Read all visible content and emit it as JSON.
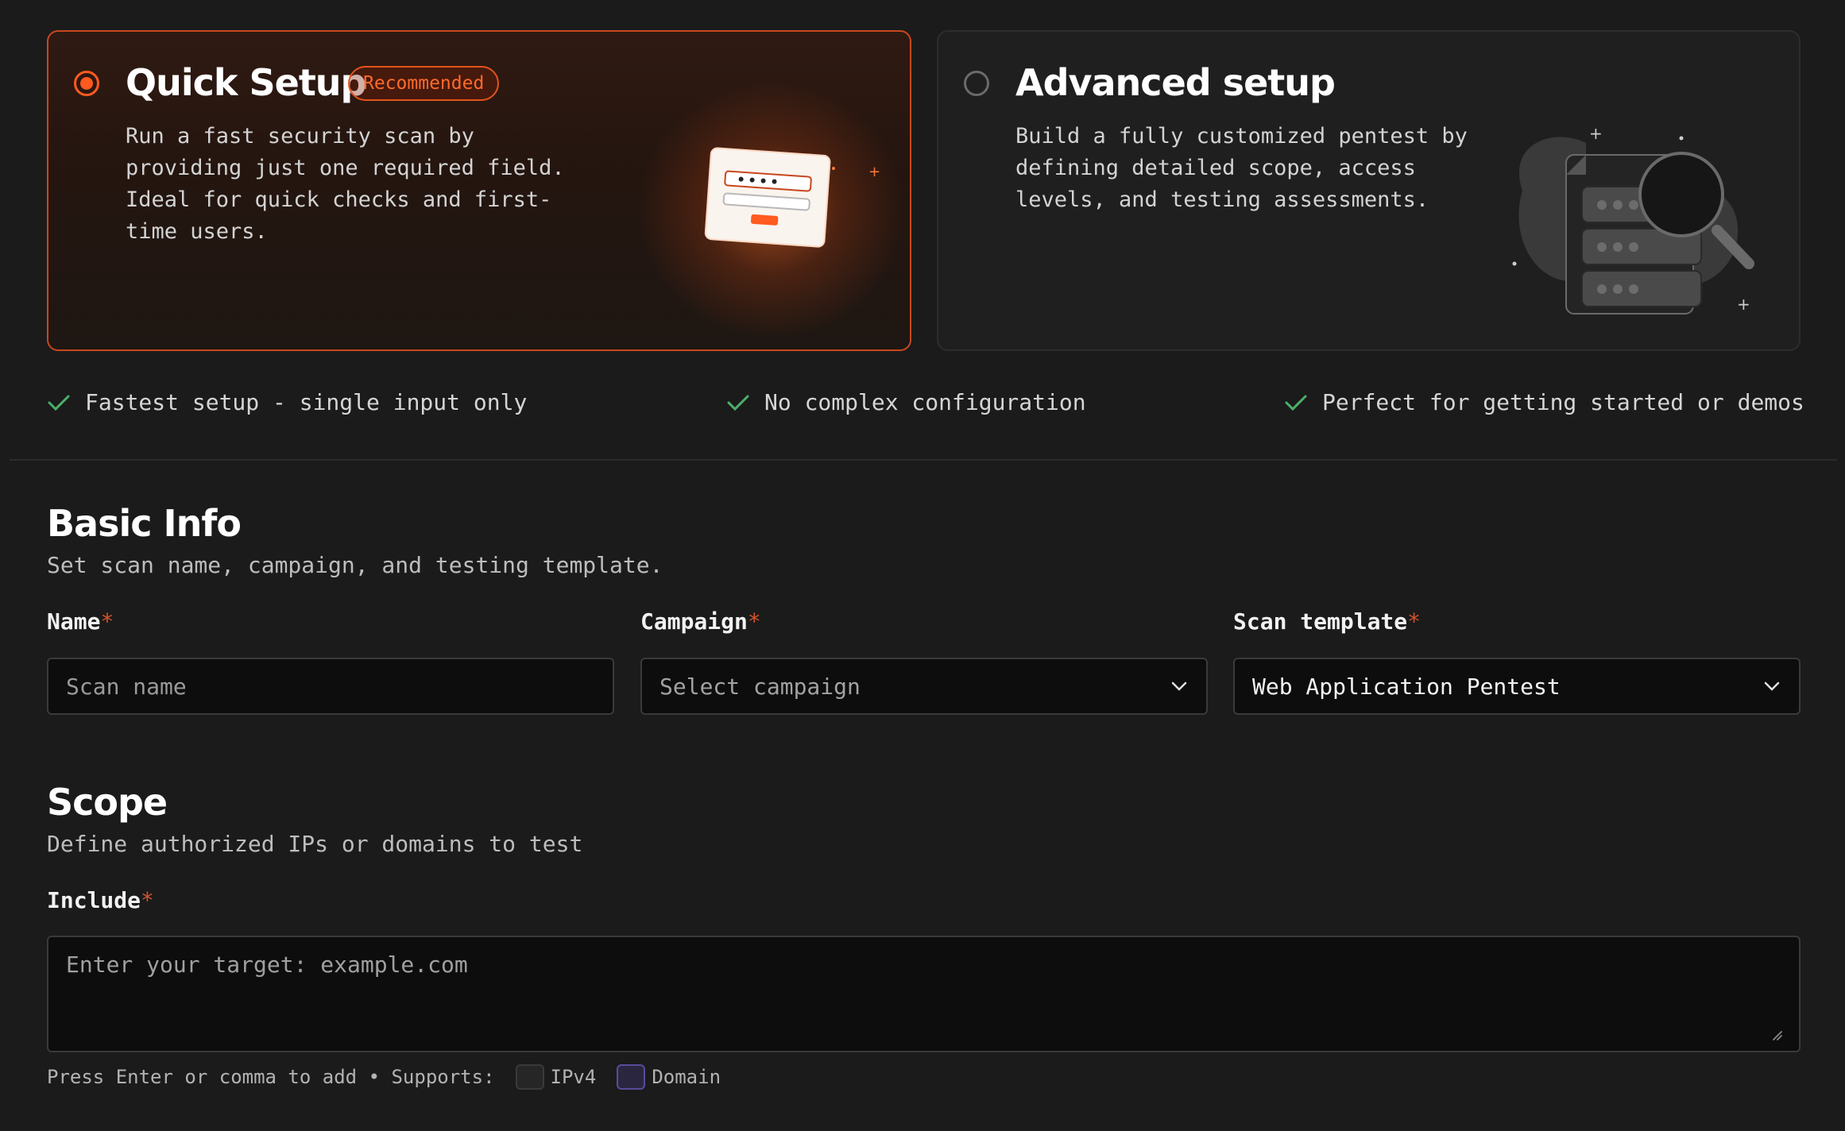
{
  "setup": {
    "quick": {
      "title": "Quick Setup",
      "badge": "Recommended",
      "description": "Run a fast security scan by\nproviding just one required field.\nIdeal for quick checks and first-\ntime users.",
      "selected": true
    },
    "advanced": {
      "title": "Advanced setup",
      "description": "Build a fully customized pentest by\ndefining detailed scope, access\nlevels, and testing assessments.",
      "selected": false
    }
  },
  "features": [
    "Fastest setup - single input only",
    "No complex configuration",
    "Perfect for getting started or demos"
  ],
  "basic_info": {
    "title": "Basic Info",
    "subtitle": "Set scan name, campaign, and testing template.",
    "name": {
      "label": "Name",
      "placeholder": "Scan name",
      "value": ""
    },
    "campaign": {
      "label": "Campaign",
      "placeholder": "Select campaign"
    },
    "template": {
      "label": "Scan template",
      "value": "Web Application Pentest"
    },
    "required_mark": "*"
  },
  "scope": {
    "title": "Scope",
    "subtitle": "Define authorized IPs or domains to test",
    "include": {
      "label": "Include",
      "placeholder": "Enter your target: example.com"
    },
    "hint": "Press Enter or comma to add • Supports:",
    "types": [
      "IPv4",
      "Domain"
    ]
  },
  "colors": {
    "accent": "#ff5a1f",
    "required": "#d4532a",
    "check": "#4caf6a",
    "background": "#1b1b1b"
  }
}
